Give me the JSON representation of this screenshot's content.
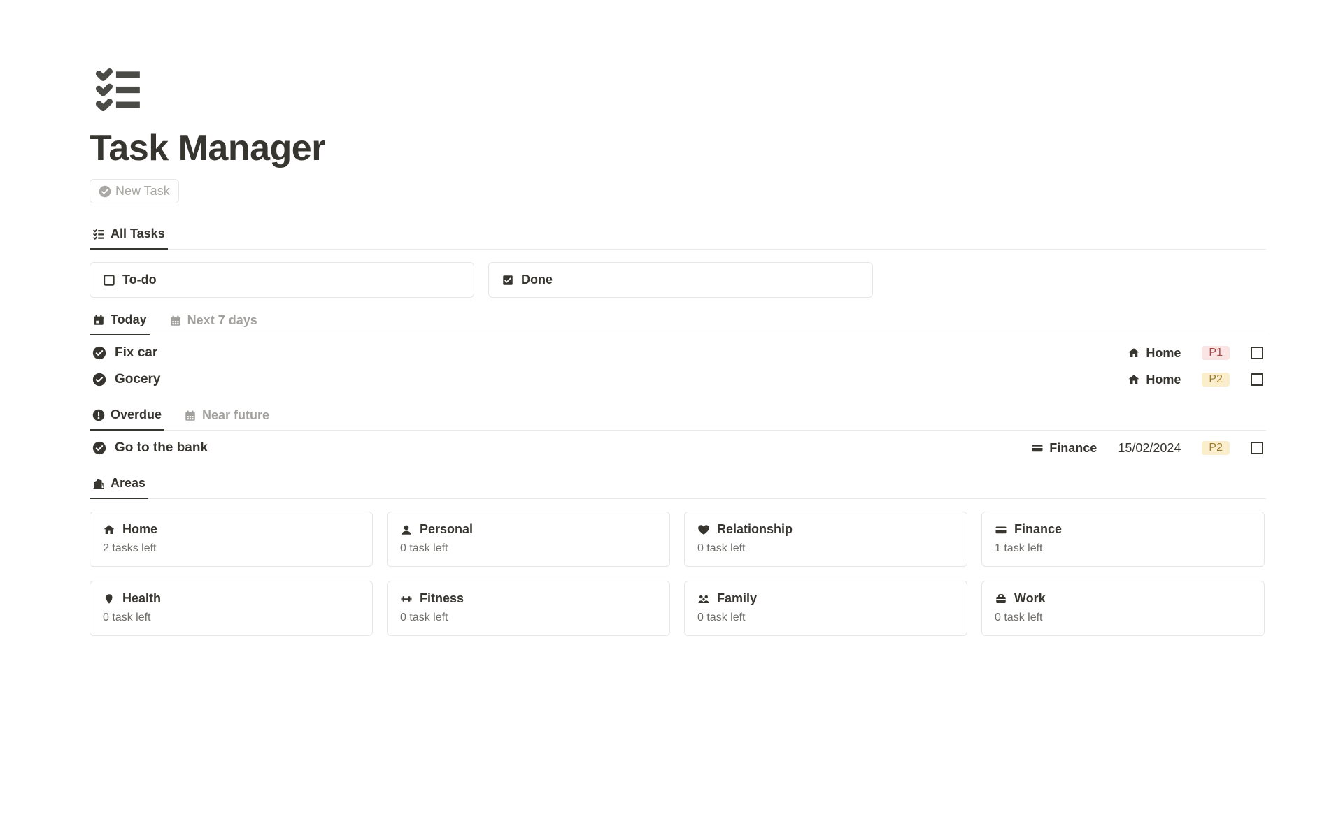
{
  "page": {
    "title": "Task Manager",
    "new_task_label": "New Task"
  },
  "tabs_main": {
    "all_tasks": "All Tasks"
  },
  "status_cards": {
    "todo": "To-do",
    "done": "Done"
  },
  "tabs_time": {
    "today": "Today",
    "next7": "Next 7 days"
  },
  "today_tasks": [
    {
      "name": "Fix car",
      "area": "Home",
      "area_icon": "home",
      "date": "",
      "priority": "P1",
      "prio_class": "p1"
    },
    {
      "name": "Gocery",
      "area": "Home",
      "area_icon": "home",
      "date": "",
      "priority": "P2",
      "prio_class": "p2"
    }
  ],
  "tabs_due": {
    "overdue": "Overdue",
    "near_future": "Near future"
  },
  "overdue_tasks": [
    {
      "name": "Go to the bank",
      "area": "Finance",
      "area_icon": "finance",
      "date": "15/02/2024",
      "priority": "P2",
      "prio_class": "p2"
    }
  ],
  "tabs_areas": {
    "areas": "Areas"
  },
  "areas": [
    {
      "icon": "home",
      "name": "Home",
      "sub": "2 tasks left"
    },
    {
      "icon": "person",
      "name": "Personal",
      "sub": "0 task left"
    },
    {
      "icon": "heart",
      "name": "Relationship",
      "sub": "0 task left"
    },
    {
      "icon": "finance",
      "name": "Finance",
      "sub": "1 task left"
    },
    {
      "icon": "health",
      "name": "Health",
      "sub": "0 task left"
    },
    {
      "icon": "fitness",
      "name": "Fitness",
      "sub": "0 task left"
    },
    {
      "icon": "family",
      "name": "Family",
      "sub": "0 task left"
    },
    {
      "icon": "work",
      "name": "Work",
      "sub": "0 task left"
    }
  ]
}
